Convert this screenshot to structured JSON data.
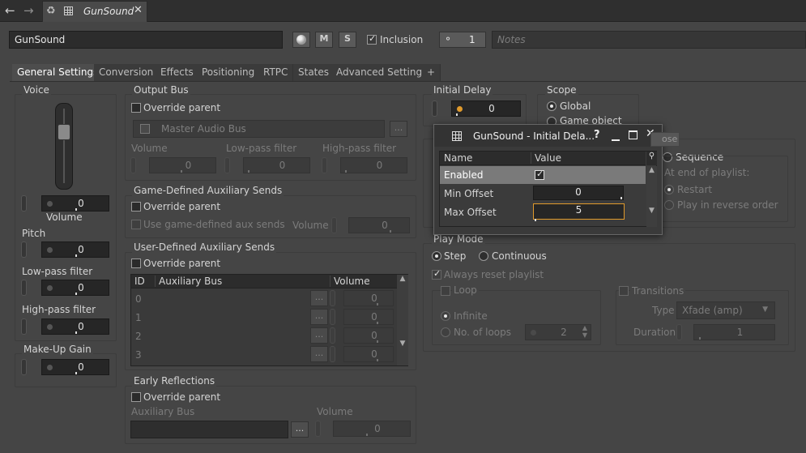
{
  "titlebar": {
    "tab_title": "GunSound"
  },
  "header": {
    "name_value": "GunSound",
    "m_label": "M",
    "s_label": "S",
    "inclusion_label": "Inclusion",
    "share_count": "1",
    "notes_placeholder": "Notes"
  },
  "tabs": [
    "General Settings",
    "Conversion",
    "Effects",
    "Positioning",
    "RTPC",
    "States",
    "Advanced Settings",
    "+"
  ],
  "voice": {
    "title": "Voice",
    "volume_value": "0",
    "volume_label": "Volume",
    "pitch_label": "Pitch",
    "pitch_value": "0",
    "lpf_label": "Low-pass filter",
    "lpf_value": "0",
    "hpf_label": "High-pass filter",
    "hpf_value": "0"
  },
  "makeup": {
    "title": "Make-Up Gain",
    "value": "0"
  },
  "output_bus": {
    "title": "Output Bus",
    "override_label": "Override parent",
    "bus_name": "Master Audio Bus",
    "browse_label": "...",
    "volume_label": "Volume",
    "lpf_label": "Low-pass filter",
    "hpf_label": "High-pass filter",
    "volume_value": "0",
    "lpf_value": "0",
    "hpf_value": "0"
  },
  "game_aux": {
    "title": "Game-Defined Auxiliary Sends",
    "override_label": "Override parent",
    "use_label": "Use game-defined aux sends",
    "volume_label": "Volume",
    "volume_value": "0"
  },
  "user_aux": {
    "title": "User-Defined Auxiliary Sends",
    "override_label": "Override parent",
    "col_id": "ID",
    "col_bus": "Auxiliary Bus",
    "col_volume": "Volume",
    "rows": [
      {
        "id": "0",
        "browse": "...",
        "volume": "0"
      },
      {
        "id": "1",
        "browse": "...",
        "volume": "0"
      },
      {
        "id": "2",
        "browse": "...",
        "volume": "0"
      },
      {
        "id": "3",
        "browse": "...",
        "volume": "0"
      }
    ]
  },
  "early_reflections": {
    "title": "Early Reflections",
    "override_label": "Override parent",
    "aux_label": "Auxiliary Bus",
    "browse_label": "...",
    "volume_label": "Volume",
    "volume_value": "0"
  },
  "initial_delay": {
    "title": "Initial Delay",
    "value": "0"
  },
  "scope": {
    "title": "Scope",
    "global_label": "Global",
    "game_object_label": "Game object"
  },
  "playlist": {
    "sequence_label": "Sequence",
    "end_label": "At end of playlist:",
    "restart_label": "Restart",
    "reverse_label": "Play in reverse order"
  },
  "play_mode": {
    "title": "Play Mode",
    "step_label": "Step",
    "continuous_label": "Continuous",
    "always_reset_label": "Always reset playlist",
    "loop_label": "Loop",
    "infinite_label": "Infinite",
    "no_loops_label": "No. of loops",
    "no_loops_value": "2",
    "transitions_label": "Transitions",
    "type_label": "Type",
    "type_value": "Xfade (amp)",
    "duration_label": "Duration",
    "duration_value": "1"
  },
  "popup": {
    "title": "GunSound - Initial Dela...",
    "help_label": "?",
    "tooltip": "ose",
    "col_name": "Name",
    "col_value": "Value",
    "rows": [
      {
        "name": "Enabled",
        "value": ""
      },
      {
        "name": "Min Offset",
        "value": "0"
      },
      {
        "name": "Max Offset",
        "value": "5"
      }
    ]
  },
  "colors": {
    "background": "#454545",
    "accent": "#e09a2c",
    "selected_row": "#7a7a7a",
    "field": "#262626"
  }
}
